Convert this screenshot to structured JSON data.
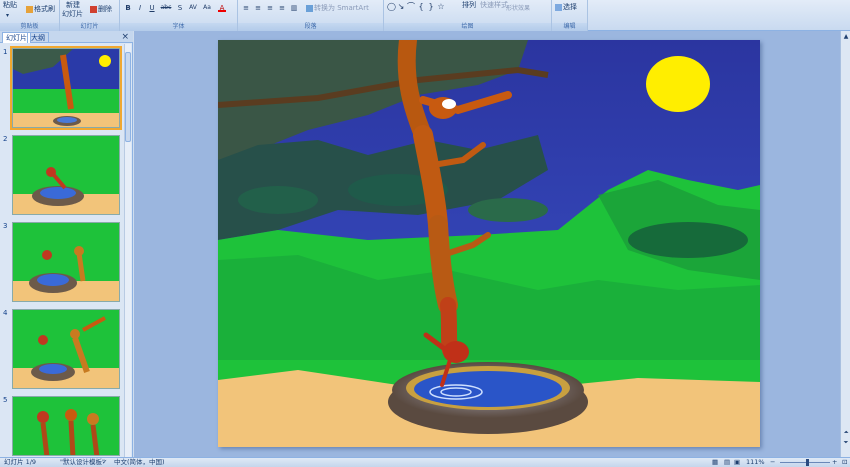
{
  "ribbon": {
    "clipboard": {
      "paste": "粘贴",
      "format_painter": "格式刷",
      "label": "剪贴板"
    },
    "slides": {
      "new_slide": "新建",
      "new_slide2": "幻灯片",
      "delete": "删除",
      "label": "幻灯片"
    },
    "font": {
      "label": "字体",
      "buttons": [
        "B",
        "I",
        "U",
        "abc",
        "S",
        "AV",
        "Aa",
        "A"
      ]
    },
    "paragraph": {
      "label": "段落",
      "smartart": "转换为 SmartArt"
    },
    "drawing": {
      "label": "绘图",
      "arrange": "排列",
      "quick_styles": "快速样式",
      "shape_effects": "形状效果"
    },
    "editing": {
      "label": "编辑",
      "select": "选择"
    }
  },
  "left_pane": {
    "tabs": [
      "幻灯片",
      "大纲"
    ],
    "close": "×",
    "slide_numbers": [
      "1",
      "2",
      "3",
      "4",
      "5"
    ]
  },
  "status": {
    "slide_info": "幻灯片 1/9",
    "theme": "\"默认设计模板\"",
    "language": "中文(简体，中国)",
    "zoom": "111%",
    "minus": "−",
    "plus": "+"
  },
  "colors": {
    "ribbon_bg": "#dbe7f6",
    "stage_bg": "#9bb6df",
    "sky": "#2a3aa8",
    "moon": "#ffee00",
    "grass": "#1ec23a",
    "sand": "#f2c47a",
    "monkey": "#c85a10"
  }
}
